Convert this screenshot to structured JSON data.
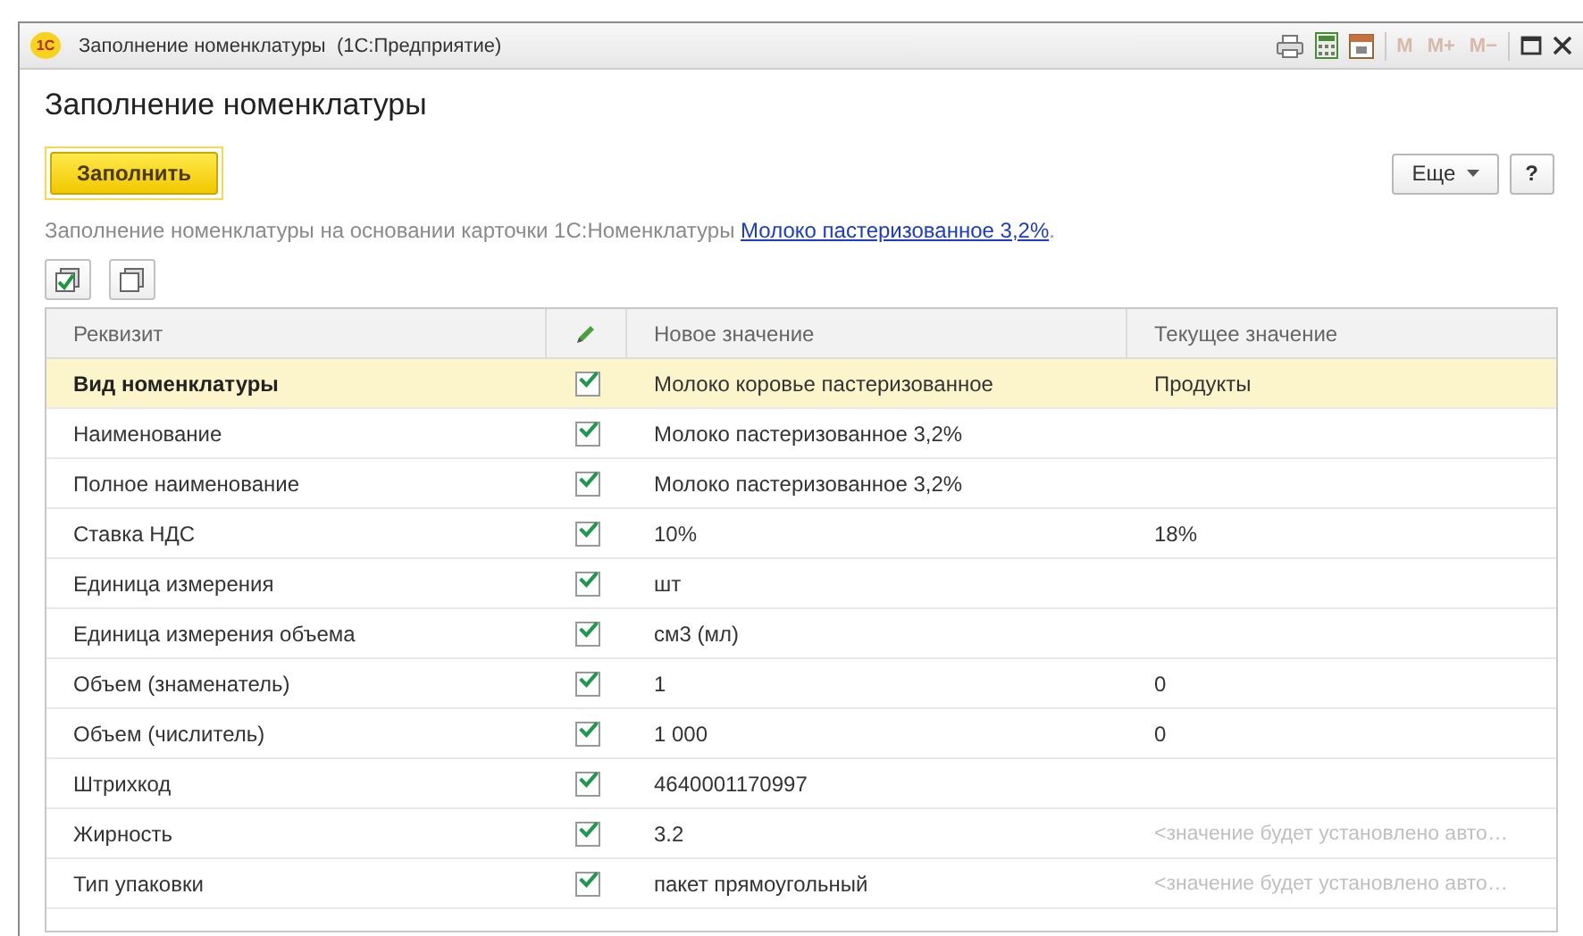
{
  "window": {
    "app_badge": "1С",
    "title": "Заполнение номенклатуры  (1С:Предприятие)",
    "memory_buttons": [
      {
        "label": "M",
        "disabled": true
      },
      {
        "label": "M+",
        "disabled": true
      },
      {
        "label": "M−",
        "disabled": true
      }
    ]
  },
  "form": {
    "title": "Заполнение номенклатуры",
    "fill_button": "Заполнить",
    "more_button": "Еще",
    "help_button": "?",
    "info": "Заполнение номенклатуры на основании карточки 1С:Номенклатуры",
    "info_link": "Молоко пастеризованное 3,2%",
    "info_end": "."
  },
  "table": {
    "columns": [
      "Реквизит",
      "Новое значение",
      "Текущее значение"
    ],
    "rows": [
      {
        "name": "Вид номенклатуры",
        "checked": true,
        "selected": true,
        "new": "Молоко коровье пастеризованное",
        "current": "Продукты",
        "current_hint": false
      },
      {
        "name": "Наименование",
        "checked": true,
        "selected": false,
        "new": "Молоко пастеризованное 3,2%"
      },
      {
        "name": "Полное наименование",
        "checked": true,
        "selected": false,
        "new": "Молоко пастеризованное 3,2%"
      },
      {
        "name": "Ставка НДС",
        "checked": true,
        "selected": false,
        "new": "10%",
        "current": "18%",
        "current_hint": false
      },
      {
        "name": "Единица измерения",
        "checked": true,
        "selected": false,
        "new": "шт"
      },
      {
        "name": "Единица измерения объема",
        "checked": true,
        "selected": false,
        "new": "см3 (мл)"
      },
      {
        "name": "Объем (знаменатель)",
        "checked": true,
        "selected": false,
        "new": "1",
        "current": "0",
        "current_hint": false
      },
      {
        "name": "Объем (числитель)",
        "checked": true,
        "selected": false,
        "new": "1 000",
        "current": "0",
        "current_hint": false
      },
      {
        "name": "Штрихкод",
        "checked": true,
        "selected": false,
        "new": "4640001170997"
      },
      {
        "name": "Жирность",
        "checked": true,
        "selected": false,
        "new": "3.2",
        "current": "<значение будет установлено авто…",
        "current_hint": true
      },
      {
        "name": "Тип упаковки",
        "checked": true,
        "selected": false,
        "new": "пакет прямоугольный",
        "current": "<значение будет установлено авто…",
        "current_hint": true
      }
    ]
  }
}
